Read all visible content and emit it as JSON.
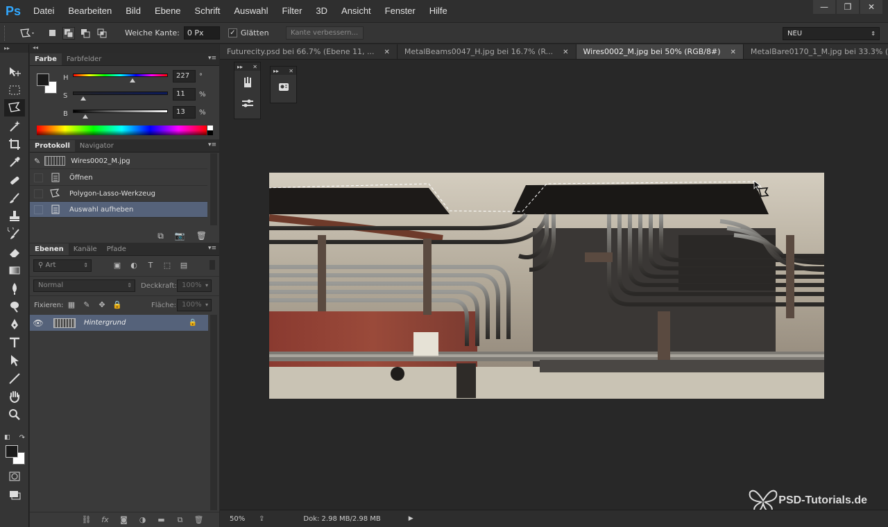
{
  "app": {
    "logo": "Ps"
  },
  "menu": [
    "Datei",
    "Bearbeiten",
    "Bild",
    "Ebene",
    "Schrift",
    "Auswahl",
    "Filter",
    "3D",
    "Ansicht",
    "Fenster",
    "Hilfe"
  ],
  "window_controls": {
    "minimize": "—",
    "restore": "❐",
    "close": "✕"
  },
  "options": {
    "feather_label": "Weiche Kante:",
    "feather_value": "0 Px",
    "antialias_label": "Glätten",
    "antialias_checked": "✓",
    "refine_edge": "Kante verbessern...",
    "workspace": "NEU"
  },
  "color_panel": {
    "tabs": [
      "Farbe",
      "Farbfelder"
    ],
    "h_label": "H",
    "h_value": "227",
    "h_unit": "°",
    "h_fraction": 0.63,
    "s_label": "S",
    "s_value": "11",
    "s_unit": "%",
    "s_fraction": 0.11,
    "b_label": "B",
    "b_value": "13",
    "b_unit": "%",
    "b_fraction": 0.13
  },
  "history_panel": {
    "tabs": [
      "Protokoll",
      "Navigator"
    ],
    "snapshot": "Wires0002_M.jpg",
    "steps": [
      "Öffnen",
      "Polygon-Lasso-Werkzeug",
      "Auswahl aufheben"
    ]
  },
  "layers_panel": {
    "tabs": [
      "Ebenen",
      "Kanäle",
      "Pfade"
    ],
    "filter_placeholder": "Art",
    "blend_mode": "Normal",
    "opacity_label": "Deckkraft:",
    "opacity_value": "100%",
    "lock_label": "Fixieren:",
    "fill_label": "Fläche:",
    "fill_value": "100%",
    "layers": [
      {
        "name": "Hintergrund",
        "visible": true,
        "locked": true
      }
    ]
  },
  "doc_tabs": [
    {
      "label": "Futurecity.psd bei 66.7% (Ebene 11, ...",
      "active": false
    },
    {
      "label": "MetalBeams0047_H.jpg bei 16.7% (R...",
      "active": false
    },
    {
      "label": "Wires0002_M.jpg bei 50% (RGB/8#)",
      "active": true
    },
    {
      "label": "MetalBare0170_1_M.jpg bei 33.3% (...",
      "active": false
    }
  ],
  "status": {
    "zoom": "50%",
    "doc_size": "Dok: 2.98 MB/2.98 MB"
  },
  "watermark": "PSD-Tutorials.de",
  "colors": {
    "accent": "#31a8ff",
    "selection": "#55627a",
    "background": "#282828"
  },
  "icons": {
    "tools": [
      "move-icon",
      "marquee-icon",
      "polygon-lasso-icon",
      "magic-wand-icon",
      "crop-icon",
      "eyedropper-icon",
      "healing-brush-icon",
      "brush-icon",
      "clone-stamp-icon",
      "history-brush-icon",
      "eraser-icon",
      "gradient-icon",
      "blur-icon",
      "dodge-icon",
      "pen-icon",
      "type-icon",
      "path-selection-icon",
      "line-icon",
      "hand-icon",
      "zoom-icon"
    ]
  }
}
